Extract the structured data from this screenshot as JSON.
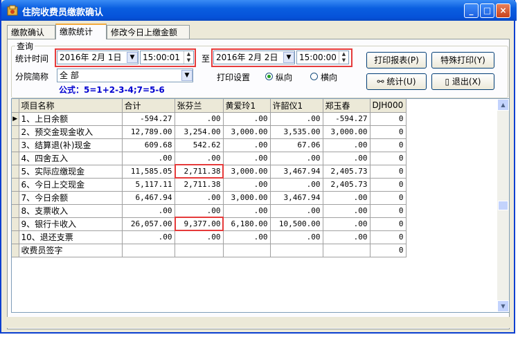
{
  "window": {
    "title": "住院收费员缴款确认",
    "min": "_",
    "max": "□",
    "close": "×"
  },
  "tabs": [
    "缴款确认",
    "缴款统计",
    "修改今日上缴金额"
  ],
  "query": {
    "group_title": "查询",
    "time_label": "统计时间",
    "start_date": "2016年 2月 1日",
    "start_time": "15:00:01",
    "to_label": "至",
    "end_date": "2016年 2月 2日",
    "end_time": "15:00:00",
    "branch_label": "分院简称",
    "branch_value": "全 部",
    "formula": "公式：5=1+2-3-4;7=5-6",
    "print_settings_label": "打印设置",
    "portrait_label": "纵向",
    "landscape_label": "横向",
    "orientation_selected": "纵向"
  },
  "buttons": {
    "print_report": "打印报表(P)",
    "special_print": "特殊打印(Y)",
    "stats": "统计(U)",
    "exit": "退出(X)"
  },
  "grid": {
    "headers": [
      "项目名称",
      "合计",
      "张芬兰",
      "黄爱玲1",
      "许韶仪1",
      "郑玉春",
      "DJH000"
    ],
    "rows": [
      [
        "1、上日余额",
        "-594.27",
        ".00",
        ".00",
        ".00",
        "-594.27",
        "0"
      ],
      [
        "2、预交金现金收入",
        "12,789.00",
        "3,254.00",
        "3,000.00",
        "3,535.00",
        "3,000.00",
        "0"
      ],
      [
        "3、结算退(补)现金",
        "609.68",
        "542.62",
        ".00",
        "67.06",
        ".00",
        "0"
      ],
      [
        "4、四舍五入",
        ".00",
        ".00",
        ".00",
        ".00",
        ".00",
        "0"
      ],
      [
        "5、实际应缴现金",
        "11,585.05",
        "2,711.38",
        "3,000.00",
        "3,467.94",
        "2,405.73",
        "0"
      ],
      [
        "6、今日上交现金",
        "5,117.11",
        "2,711.38",
        ".00",
        ".00",
        "2,405.73",
        "0"
      ],
      [
        "7、今日余额",
        "6,467.94",
        ".00",
        "3,000.00",
        "3,467.94",
        ".00",
        "0"
      ],
      [
        "8、支票收入",
        ".00",
        ".00",
        ".00",
        ".00",
        ".00",
        "0"
      ],
      [
        "9、银行卡收入",
        "26,057.00",
        "9,377.00",
        "6,180.00",
        "10,500.00",
        ".00",
        "0"
      ],
      [
        "10、退还支票",
        ".00",
        ".00",
        ".00",
        ".00",
        ".00",
        "0"
      ],
      [
        "收费员签字",
        "",
        "",
        "",
        "",
        "",
        "0"
      ]
    ]
  },
  "colors": {
    "title_bar": "#0a5ee0",
    "highlight": "#e53a3a",
    "formula": "#0000d0"
  }
}
